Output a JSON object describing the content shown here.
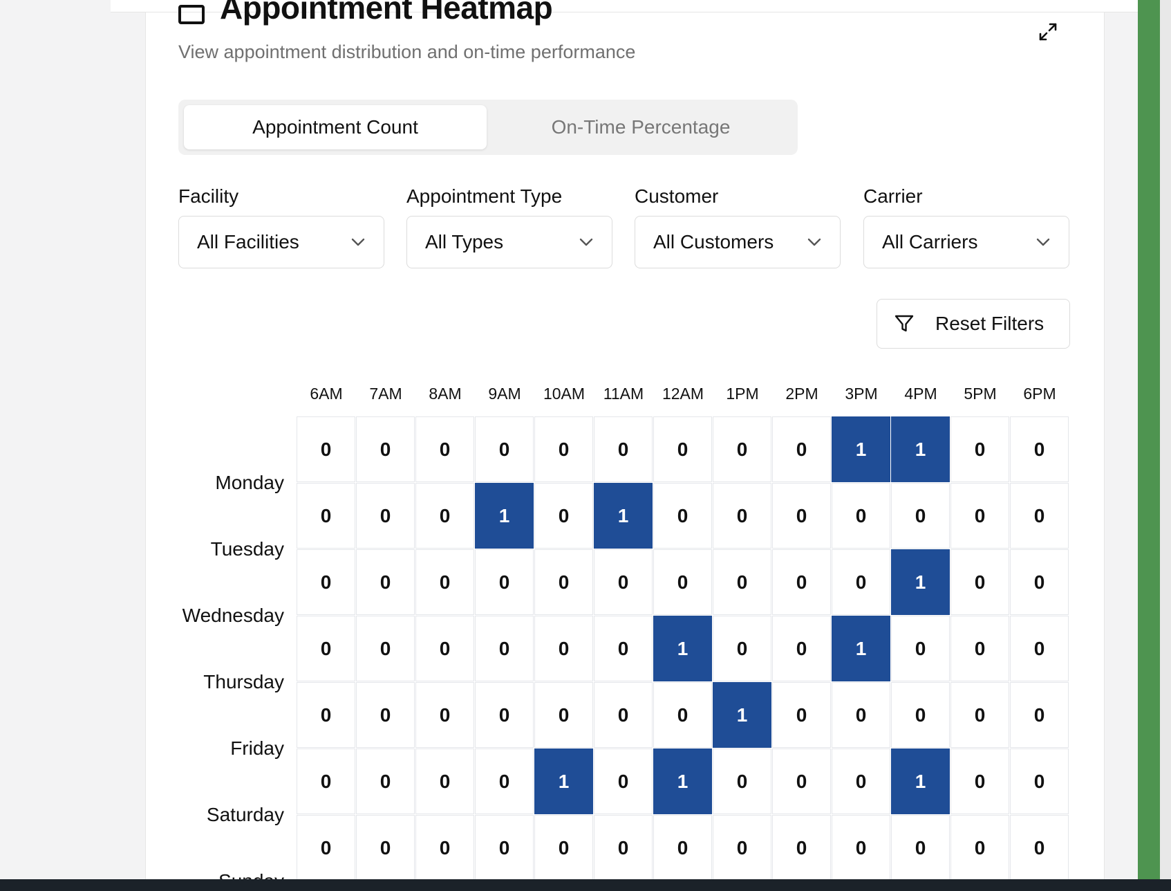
{
  "header": {
    "title": "Appointment Heatmap",
    "subtitle": "View appointment distribution and on-time performance",
    "calendar_icon": "calendar-icon",
    "expand_icon": "expand-icon"
  },
  "tabs": [
    {
      "label": "Appointment Count",
      "active": true
    },
    {
      "label": "On-Time Percentage",
      "active": false
    }
  ],
  "filters": [
    {
      "label": "Facility",
      "value": "All Facilities"
    },
    {
      "label": "Appointment Type",
      "value": "All Types"
    },
    {
      "label": "Customer",
      "value": "All Customers"
    },
    {
      "label": "Carrier",
      "value": "All Carriers"
    }
  ],
  "reset_button": {
    "label": "Reset Filters",
    "icon": "filter-icon"
  },
  "colors": {
    "accent": "#1f4d96",
    "sidebar_green": "#4e9450"
  },
  "chart_data": {
    "type": "heatmap",
    "x": [
      "6AM",
      "7AM",
      "8AM",
      "9AM",
      "10AM",
      "11AM",
      "12AM",
      "1PM",
      "2PM",
      "3PM",
      "4PM",
      "5PM",
      "6PM"
    ],
    "y": [
      "Monday",
      "Tuesday",
      "Wednesday",
      "Thursday",
      "Friday",
      "Saturday",
      "Sunday"
    ],
    "values": [
      [
        0,
        0,
        0,
        0,
        0,
        0,
        0,
        0,
        0,
        1,
        1,
        0,
        0
      ],
      [
        0,
        0,
        0,
        1,
        0,
        1,
        0,
        0,
        0,
        0,
        0,
        0,
        0
      ],
      [
        0,
        0,
        0,
        0,
        0,
        0,
        0,
        0,
        0,
        0,
        1,
        0,
        0
      ],
      [
        0,
        0,
        0,
        0,
        0,
        0,
        1,
        0,
        0,
        1,
        0,
        0,
        0
      ],
      [
        0,
        0,
        0,
        0,
        0,
        0,
        0,
        1,
        0,
        0,
        0,
        0,
        0
      ],
      [
        0,
        0,
        0,
        0,
        1,
        0,
        1,
        0,
        0,
        0,
        1,
        0,
        0
      ],
      [
        0,
        0,
        0,
        0,
        0,
        0,
        0,
        0,
        0,
        0,
        0,
        0,
        0
      ]
    ]
  }
}
